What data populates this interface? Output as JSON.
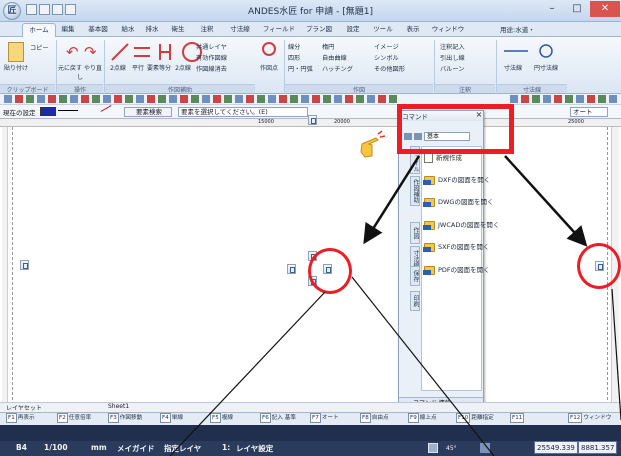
{
  "title_bar": {
    "app_title": "ANDES水匠 for 申請 - [無題1]",
    "orb": "匠",
    "minimize": "–",
    "maximize": "□",
    "close": "✕"
  },
  "ribbon_tabs": [
    "ホーム",
    "編集",
    "基本図",
    "給水",
    "排水",
    "衛生",
    "注釈",
    "寸法線",
    "フィールド",
    "プラン図",
    "設定",
    "ツール",
    "表示",
    "ウィンドウ"
  ],
  "user_label": "用途:水道・",
  "ribbon": {
    "clipboard": {
      "paste": "貼り付け",
      "copy": "コピー",
      "group": "クリップボード"
    },
    "operation": {
      "undo_redo": "元に戻す やり直し",
      "group": "操作"
    },
    "drawing": {
      "two_point": "2点線",
      "parallel": "平行",
      "equal_div": "要素等分",
      "two_point_b": "2点線",
      "common_layer": "共通レイヤ",
      "drawing_layer": "有効作図線",
      "delete_layer": "作図線消去",
      "group": "作図補助"
    },
    "point": {
      "label": "作図点"
    },
    "shapes": {
      "line": "線分",
      "rect": "四形",
      "circle": "円・円弧",
      "ellipse": "楕円",
      "free": "自由曲線",
      "hatch": "ハッチング",
      "group": "作図"
    },
    "image": {
      "image": "イメージ",
      "symbol": "シンボル",
      "other": "その他図形"
    },
    "annotation": {
      "note": "注釈記入",
      "leader": "引出し線",
      "balloon": "バルーン",
      "group": "注釈"
    },
    "dimension": {
      "dim": "寸法線",
      "circle_dim": "円寸法線",
      "group": "寸法線"
    }
  },
  "toolbar": {
    "current_setting": "現在の設定",
    "element_search": "要素検索",
    "select_prompt": "要素を選択してください。(E)",
    "auto": "オート"
  },
  "ruler_marks": [
    "15000",
    "20000",
    "25000"
  ],
  "command_panel": {
    "title": "コマンド",
    "dropdown": "基本",
    "vertical_tabs": [
      "ファイル",
      "作図補助",
      "作図",
      "寸法線",
      "線種",
      "保存",
      "印刷"
    ],
    "items": [
      {
        "label": "新規作成"
      },
      {
        "label": "DXFの図面を開く"
      },
      {
        "label": "DWGの図面を開く"
      },
      {
        "label": "JWCADの図面を開く"
      },
      {
        "label": "SXFの図面を開く"
      },
      {
        "label": "PDFの図面を開く"
      }
    ],
    "bottom_tabs": "コマンド 情報"
  },
  "sheet_bar": {
    "layout_tab": "レイヤセット",
    "sheet": "Sheet1"
  },
  "function_keys": [
    {
      "key": "F1",
      "label": "再表示"
    },
    {
      "key": "F2",
      "label": "任意倍率"
    },
    {
      "key": "F3",
      "label": "作図移動"
    },
    {
      "key": "F4",
      "label": "単線"
    },
    {
      "key": "F5",
      "label": "複線"
    },
    {
      "key": "F6",
      "label": "記入 基準"
    },
    {
      "key": "F7",
      "label": "オート"
    },
    {
      "key": "F8",
      "label": "自由点"
    },
    {
      "key": "F9",
      "label": "線上点"
    },
    {
      "key": "F10",
      "label": "距離指定"
    },
    {
      "key": "F11",
      "label": ""
    },
    {
      "key": "F12",
      "label": "ウィンドウ"
    }
  ],
  "status_bar": {
    "paper": "B4",
    "scale": "1/100",
    "unit": "mm",
    "guide": "メイガイド",
    "layer_mode": "指定レイヤ",
    "layer_no": "1:",
    "layer_name": "レイヤ設定",
    "angle": "45°",
    "coord_x": "25549.339",
    "coord_y": "8881.357"
  },
  "colors": {
    "highlight": "#ee1c25",
    "status_bg": "#1f2f4d",
    "ribbon_bg": "#dbe6f3"
  }
}
